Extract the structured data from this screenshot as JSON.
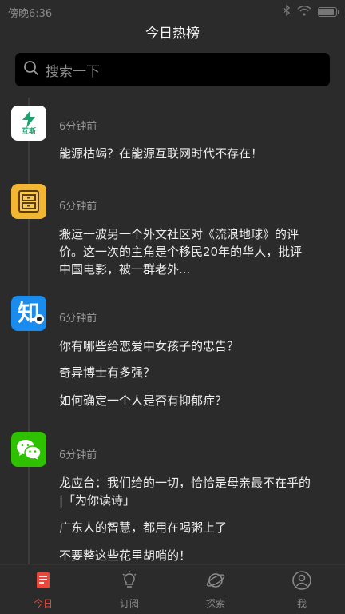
{
  "status_bar": {
    "carrier": "傍晚6:36"
  },
  "header": {
    "title": "今日热榜"
  },
  "search": {
    "placeholder": "搜索一下"
  },
  "feed": [
    {
      "app": "互联网时代",
      "app_icon": "lightning-app-icon",
      "app_icon_text": "互斯",
      "color": "#ffffff",
      "time": "6分钟前",
      "items": [
        "能源枯竭？在能源互联网时代不存在！"
      ]
    },
    {
      "app": "抽屉",
      "app_icon": "drawer-app-icon",
      "color": "#f2b632",
      "time": "6分钟前",
      "items": [
        "搬运一波另一个外文社区对《流浪地球》的评价。这一次的主角是个移民20年的华人，批评中国电影，被一群老外..."
      ]
    },
    {
      "app": "知乎",
      "app_icon": "zhihu-app-icon",
      "app_icon_text": "知",
      "color": "#1a8ced",
      "time": "6分钟前",
      "items": [
        "你有哪些给恋爱中女孩子的忠告？",
        "奇异博士有多强？",
        "如何确定一个人是否有抑郁症？"
      ]
    },
    {
      "app": "微信",
      "app_icon": "wechat-app-icon",
      "color": "#2dc100",
      "time": "6分钟前",
      "items": [
        "龙应台：我们给的一切，恰恰是母亲最不在乎的 |「为你读诗」",
        "广东人的智慧，都用在喝粥上了",
        "不要整这些花里胡哨的！"
      ]
    }
  ],
  "tabs": [
    {
      "label": "今日",
      "icon": "calendar-icon",
      "active": true
    },
    {
      "label": "订阅",
      "icon": "lightbulb-icon",
      "active": false
    },
    {
      "label": "探索",
      "icon": "planet-icon",
      "active": false
    },
    {
      "label": "我",
      "icon": "person-icon",
      "active": false
    }
  ],
  "colors": {
    "accent": "#e8483c",
    "background": "#2b2b2b"
  }
}
